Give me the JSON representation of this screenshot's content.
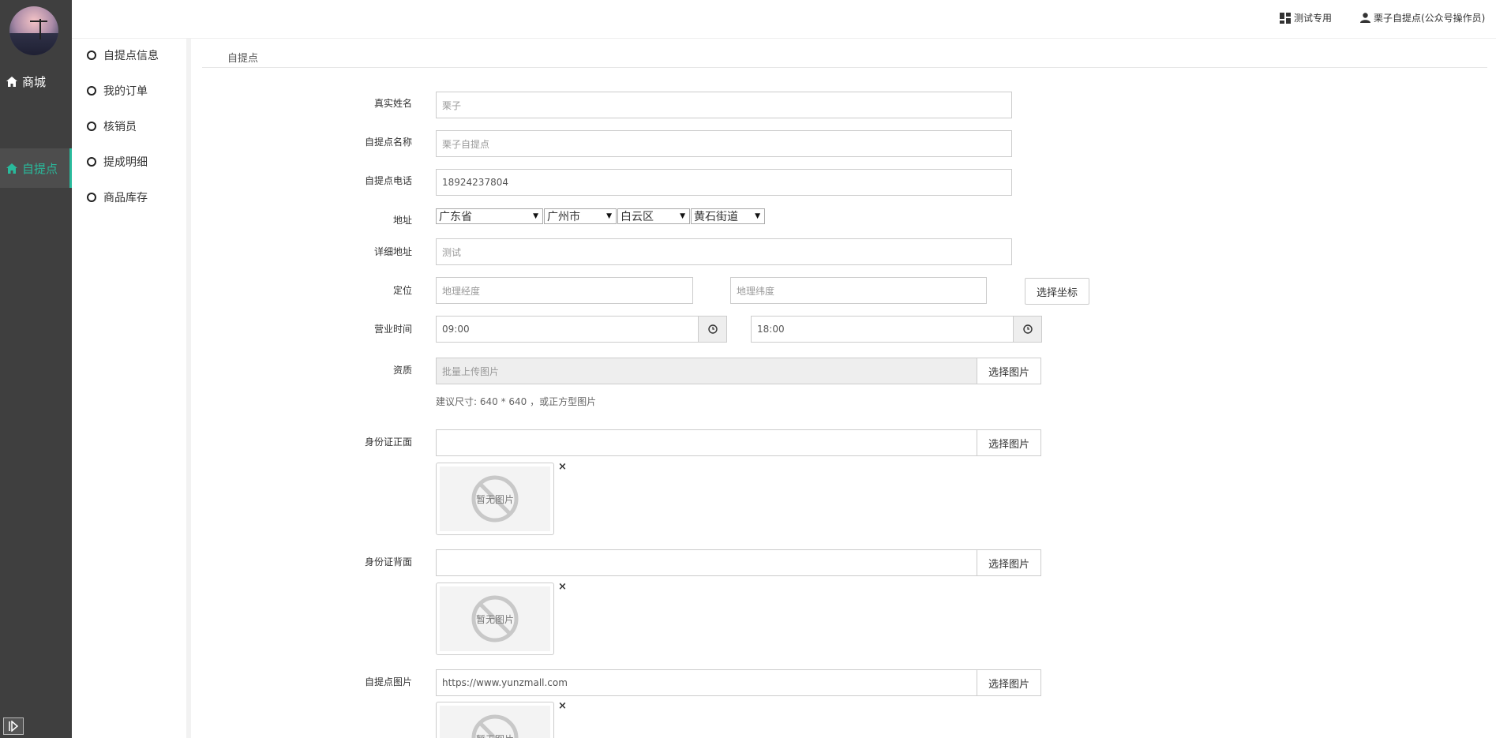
{
  "sidebar": {
    "shop_label": "商城",
    "pickup_label": "自提点"
  },
  "submenu": {
    "items": [
      "自提点信息",
      "我的订单",
      "核销员",
      "提成明细",
      "商品库存"
    ]
  },
  "topbar": {
    "test_label": "测试专用",
    "user_label": "栗子自提点(公众号操作员)"
  },
  "content": {
    "title": "自提点"
  },
  "form": {
    "real_name_label": "真实姓名",
    "real_name_value": "栗子",
    "name_label": "自提点名称",
    "name_value": "栗子自提点",
    "phone_label": "自提点电话",
    "phone_value": "18924237804",
    "address_label": "地址",
    "province": "广东省",
    "city": "广州市",
    "district": "白云区",
    "street": "黄石街道",
    "detail_label": "详细地址",
    "detail_value": "测试",
    "location_label": "定位",
    "lng_placeholder": "地理经度",
    "lat_placeholder": "地理纬度",
    "pick_coord_label": "选择坐标",
    "hours_label": "营业时间",
    "open_time": "09:00",
    "close_time": "18:00",
    "qual_label": "资质",
    "qual_placeholder": "批量上传图片",
    "select_image_label": "选择图片",
    "size_hint": "建议尺寸: 640 * 640 ，或正方型图片",
    "id_front_label": "身份证正面",
    "id_back_label": "身份证背面",
    "store_image_label": "自提点图片",
    "store_image_value": "https://www.yunzmall.com",
    "no_image_text": "暂无图片",
    "remove_glyph": "×"
  },
  "colors": {
    "sidebar_bg": "#3f3f3f",
    "accent": "#29ba9c"
  }
}
